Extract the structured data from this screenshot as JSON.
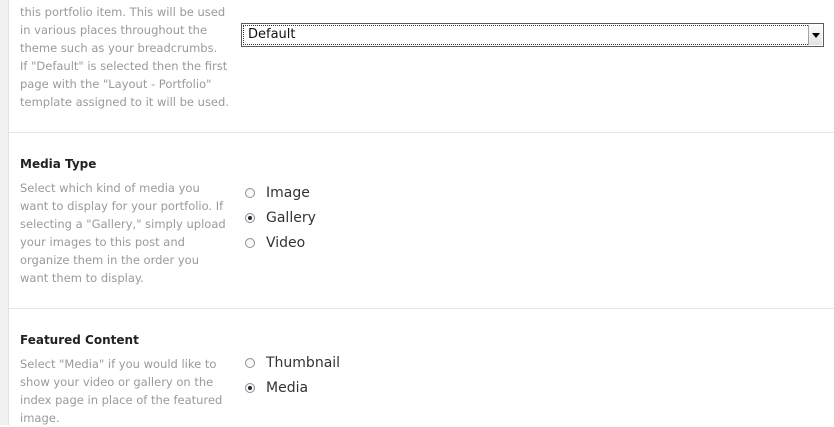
{
  "page_template": {
    "description_lines": [
      "this portfolio item. This will be used",
      "in various places throughout the",
      "theme such as your breadcrumbs.",
      "If \"Default\" is selected then the first",
      "page with the \"Layout - Portfolio\"",
      "template assigned to it will be used."
    ],
    "select_value": "Default"
  },
  "media_type": {
    "label": "Media Type",
    "description_lines": [
      "Select which kind of media you",
      "want to display for your portfolio. If",
      "selecting a \"Gallery,\" simply upload",
      "your images to this post and",
      "organize them in the order you",
      "want them to display."
    ],
    "options": [
      {
        "label": "Image",
        "checked": false
      },
      {
        "label": "Gallery",
        "checked": true
      },
      {
        "label": "Video",
        "checked": false
      }
    ]
  },
  "featured_content": {
    "label": "Featured Content",
    "description_lines": [
      "Select \"Media\" if you would like to",
      "show your video or gallery on the",
      "index page in place of the featured",
      "image."
    ],
    "options": [
      {
        "label": "Thumbnail",
        "checked": false
      },
      {
        "label": "Media",
        "checked": true
      }
    ]
  }
}
